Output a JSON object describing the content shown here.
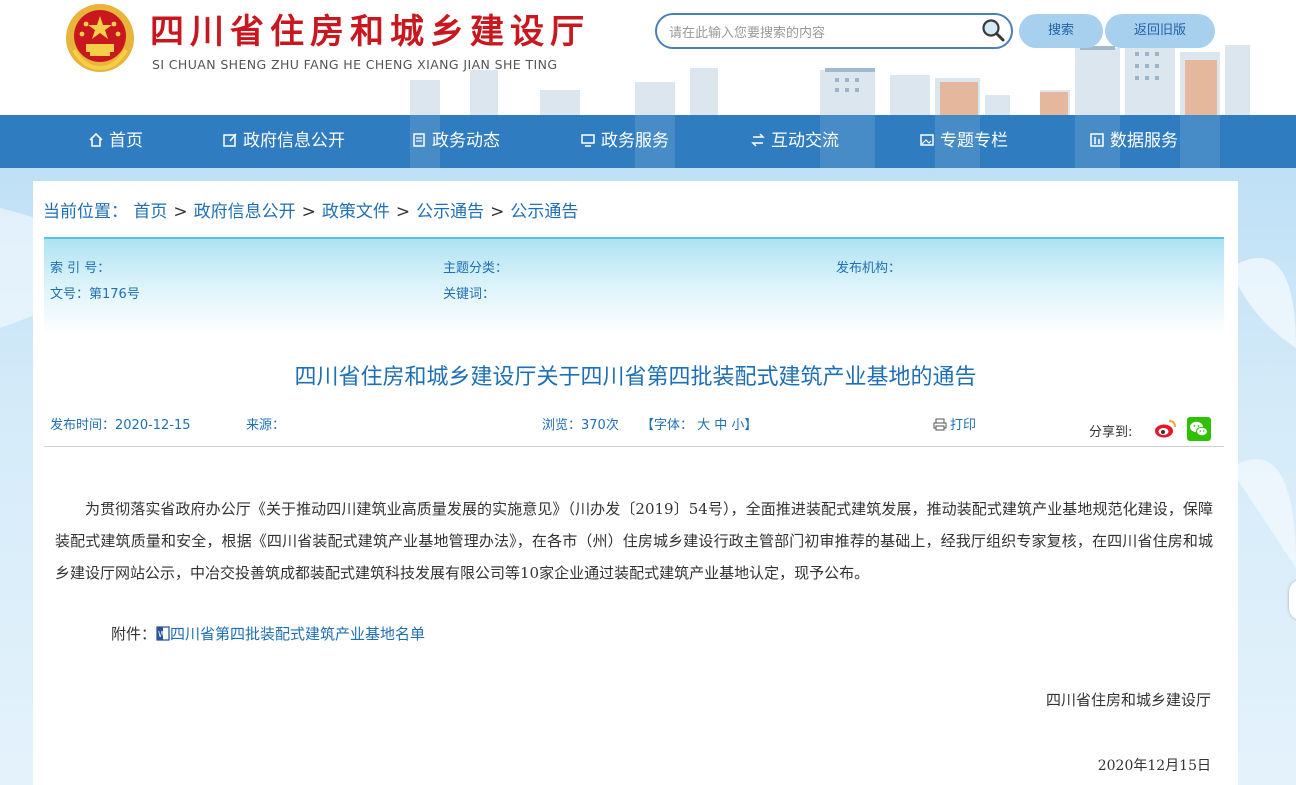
{
  "header": {
    "title": "四川省住房和城乡建设厅",
    "subtitle": "SI CHUAN SHENG ZHU FANG HE CHENG XIANG JIAN SHE TING",
    "search_placeholder": "请在此输入您要搜索的内容",
    "search_button": "搜索",
    "old_version_button": "返回旧版"
  },
  "nav": {
    "items": [
      {
        "label": "首页",
        "icon": "home-icon"
      },
      {
        "label": "政府信息公开",
        "icon": "edit-icon"
      },
      {
        "label": "政务动态",
        "icon": "document-icon"
      },
      {
        "label": "政务服务",
        "icon": "monitor-icon"
      },
      {
        "label": "互动交流",
        "icon": "exchange-icon"
      },
      {
        "label": "专题专栏",
        "icon": "image-icon"
      },
      {
        "label": "数据服务",
        "icon": "data-icon"
      }
    ]
  },
  "breadcrumb": {
    "label": "当前位置：",
    "items": [
      "首页",
      "政府信息公开",
      "政策文件",
      "公示通告",
      "公示通告"
    ],
    "separator": ">"
  },
  "meta": {
    "index_no": "索 引 号：",
    "topic": "主题分类：",
    "publisher": "发布机构：",
    "doc_no": "文号：第176号",
    "keywords": "关键词："
  },
  "article": {
    "title": "四川省住房和城乡建设厅关于四川省第四批装配式建筑产业基地的通告",
    "publish_time": "发布时间：2020-12-15",
    "source": "来源：",
    "views": "浏览：370次",
    "font_size_label": "【字体： 大 中 小】",
    "print": "打印",
    "share": "分享到:",
    "body": "为贯彻落实省政府办公厅《关于推动四川建筑业高质量发展的实施意见》（川办发〔2019〕54号），全面推进装配式建筑发展，推动装配式建筑产业基地规范化建设，保障装配式建筑质量和安全，根据《四川省装配式建筑产业基地管理办法》，在各市（州）住房城乡建设行政主管部门初审推荐的基础上，经我厅组织专家复核，在四川省住房和城乡建设厅网站公示，中冶交投善筑成都装配式建筑科技发展有限公司等10家企业通过装配式建筑产业基地认定，现予公布。",
    "attachment_label": "附件：",
    "attachment_link": "四川省第四批装配式建筑产业基地名单",
    "signature": "四川省住房和城乡建设厅",
    "date": "2020年12月15日"
  },
  "colors": {
    "title_red": "#c8171e",
    "nav_blue": "#2f7dc0",
    "link_blue": "#1f6fb5",
    "meta_band": "#aee2f2"
  }
}
